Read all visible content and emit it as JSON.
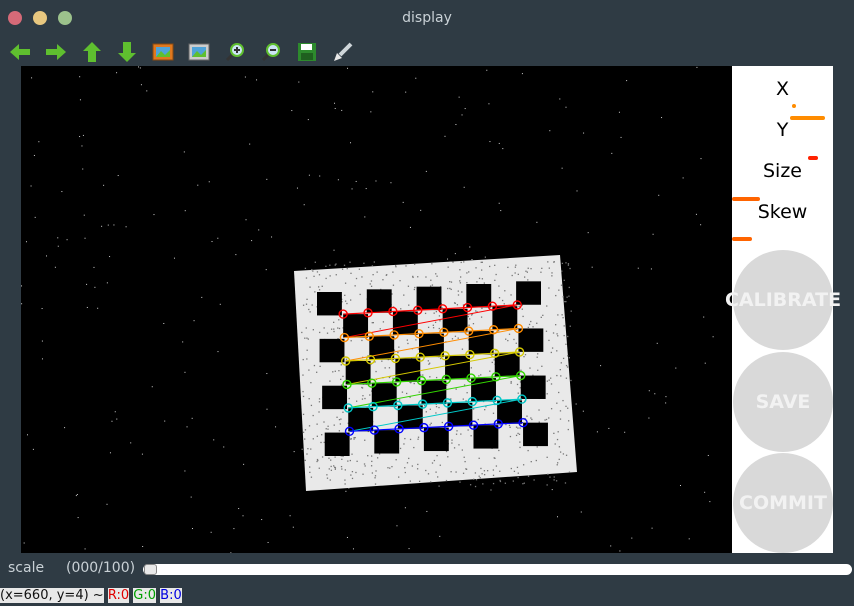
{
  "window": {
    "title": "display"
  },
  "toolbar": {
    "buttons": [
      {
        "name": "back-arrow-icon"
      },
      {
        "name": "forward-arrow-icon"
      },
      {
        "name": "up-arrow-icon"
      },
      {
        "name": "down-arrow-icon"
      },
      {
        "name": "save-image-icon"
      },
      {
        "name": "copy-image-icon"
      },
      {
        "name": "zoom-in-icon"
      },
      {
        "name": "zoom-out-icon"
      },
      {
        "name": "save-disk-icon"
      },
      {
        "name": "properties-brush-icon"
      }
    ]
  },
  "panel": {
    "labels": {
      "x": "X",
      "y": "Y",
      "size": "Size",
      "skew": "Skew"
    },
    "progress": {
      "x": 0.0,
      "y": 0.35,
      "size": 0.1,
      "skew": 0.28
    },
    "colors": {
      "x": "#ff8c00",
      "y": "#ff8c00",
      "size": "#ff2200",
      "skew": "#ff6400"
    },
    "buttons": {
      "calibrate": "CALIBRATE",
      "save": "SAVE",
      "commit": "COMMIT"
    }
  },
  "scale": {
    "label": "scale",
    "value": "(000/100)",
    "position": 0
  },
  "status": {
    "coords": "(x=660, y=4) ~",
    "r": "R:0",
    "g": "G:0",
    "b": "B:0"
  },
  "colors": {
    "window_bg": "#2f3b44",
    "panel_bg": "#ffffff",
    "button_bg": "#d9d9d9"
  }
}
